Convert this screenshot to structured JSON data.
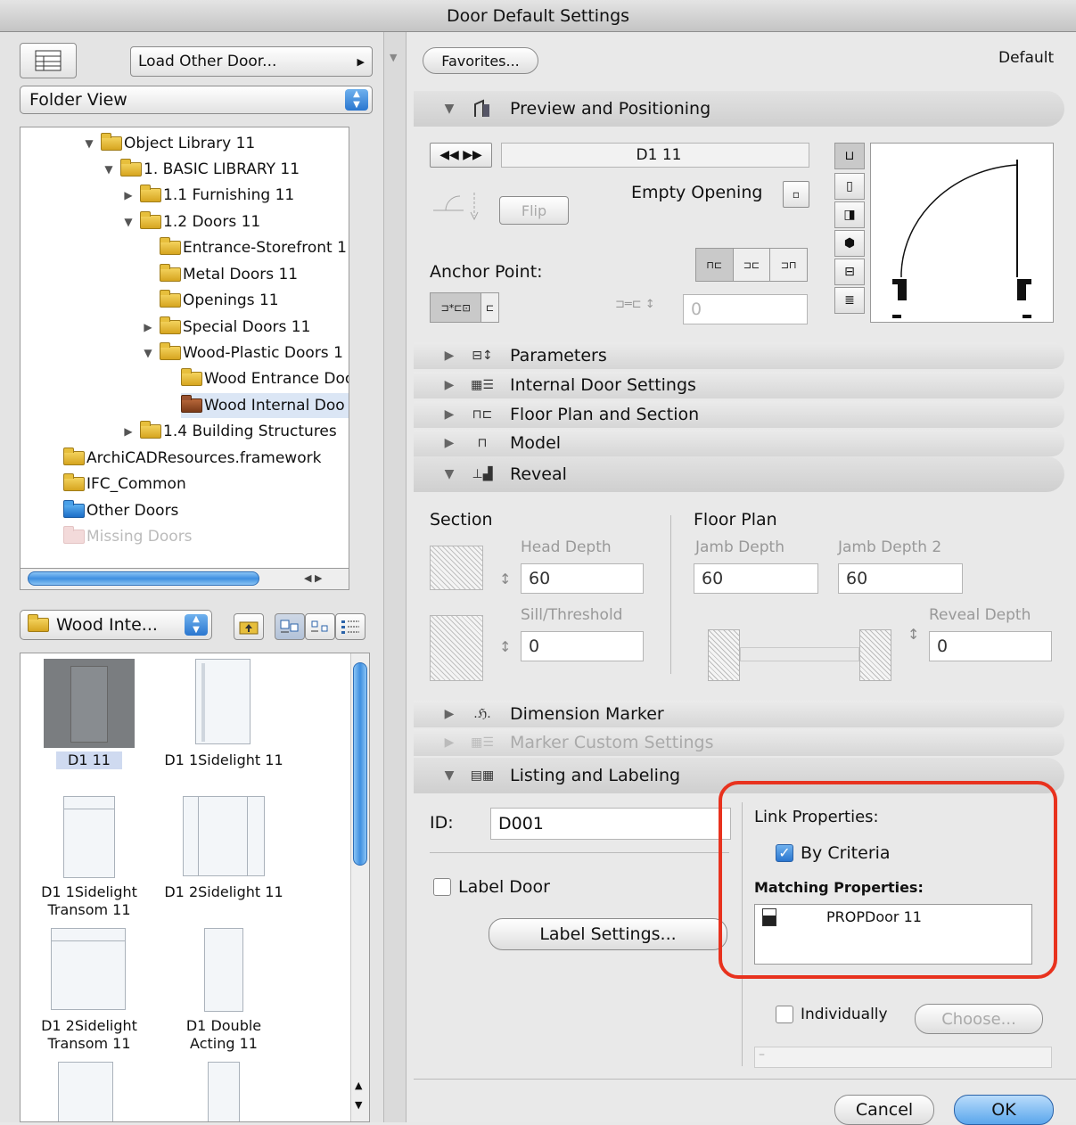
{
  "window": {
    "title": "Door Default Settings"
  },
  "left": {
    "load_other": "Load Other Door...",
    "view_select": "Folder View",
    "tree": [
      {
        "label": "Object Library 11",
        "expanded": true
      },
      {
        "label": "1. BASIC LIBRARY 11",
        "expanded": true
      },
      {
        "label": "1.1 Furnishing 11",
        "expanded": false
      },
      {
        "label": "1.2 Doors 11",
        "expanded": true
      },
      {
        "label": "Entrance-Storefront 1"
      },
      {
        "label": "Metal Doors 11"
      },
      {
        "label": "Openings 11"
      },
      {
        "label": "Special Doors 11",
        "expanded": false
      },
      {
        "label": "Wood-Plastic Doors 1",
        "expanded": true
      },
      {
        "label": "Wood Entrance Doo"
      },
      {
        "label": "Wood Internal Doo",
        "selected": true
      },
      {
        "label": "1.4 Building Structures",
        "expanded": false
      },
      {
        "label": "ArchiCADResources.framework"
      },
      {
        "label": "IFC_Common"
      },
      {
        "label": "Other Doors"
      },
      {
        "label": "Missing Doors"
      }
    ],
    "folder_select": "Wood Inte...",
    "objects": [
      {
        "label": "D1 11",
        "selected": true
      },
      {
        "label": "D1 1Sidelight 11"
      },
      {
        "label": "D1 1Sidelight Transom 11"
      },
      {
        "label": "D1 2Sidelight 11"
      },
      {
        "label": "D1 2Sidelight Transom 11"
      },
      {
        "label": "D1 Double Acting 11"
      }
    ]
  },
  "right": {
    "favorites": "Favorites...",
    "default_label": "Default",
    "sections": {
      "preview": "Preview and Positioning",
      "parameters": "Parameters",
      "internal": "Internal Door Settings",
      "floorplan": "Floor Plan and Section",
      "model": "Model",
      "reveal": "Reveal",
      "dimension": "Dimension Marker",
      "marker_custom": "Marker Custom Settings",
      "listing": "Listing and Labeling"
    },
    "preview": {
      "object_name": "D1 11",
      "empty_opening": "Empty Opening",
      "flip": "Flip",
      "anchor_point": "Anchor Point:",
      "offset_value": "0"
    },
    "reveal": {
      "section": "Section",
      "floor_plan": "Floor Plan",
      "head_depth_label": "Head Depth",
      "head_depth": "60",
      "jamb_depth_label": "Jamb Depth",
      "jamb_depth": "60",
      "jamb_depth2_label": "Jamb Depth 2",
      "jamb_depth2": "60",
      "sill_label": "Sill/Threshold",
      "sill": "0",
      "reveal_depth_label": "Reveal Depth",
      "reveal_depth": "0"
    },
    "listing": {
      "id_label": "ID:",
      "id_value": "D001",
      "label_door": "Label Door",
      "label_settings": "Label Settings...",
      "link_properties": "Link Properties:",
      "by_criteria": "By Criteria",
      "matching_properties": "Matching Properties:",
      "matching_item": "PROPDoor 11",
      "individually": "Individually",
      "choose": "Choose...",
      "empty_marker": "–"
    },
    "cancel": "Cancel",
    "ok": "OK"
  },
  "colors": {
    "highlight": "#e8321e",
    "accent": "#3f8fe0"
  }
}
